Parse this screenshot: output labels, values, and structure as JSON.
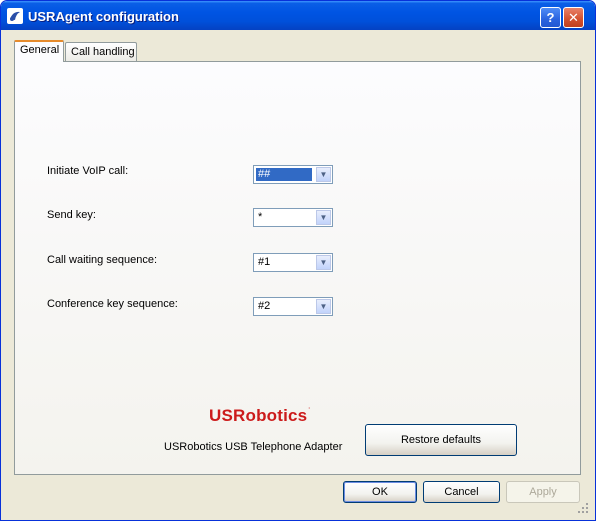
{
  "window": {
    "title": "USRAgent configuration",
    "help_label": "?",
    "close_label": "✕"
  },
  "tabs": [
    {
      "label": "General",
      "active": true
    },
    {
      "label": "Call handling",
      "active": false
    }
  ],
  "settings": [
    {
      "label": "Initiate VoIP call:",
      "value": "##"
    },
    {
      "label": "Send key:",
      "value": "*"
    },
    {
      "label": "Call waiting sequence:",
      "value": "#1"
    },
    {
      "label": "Conference key sequence:",
      "value": "#2"
    }
  ],
  "brand": {
    "logo_text": "USRobotics",
    "logo_mark": "·",
    "product_name": "USRobotics USB Telephone Adapter"
  },
  "buttons": {
    "restore": "Restore defaults",
    "ok": "OK",
    "cancel": "Cancel",
    "apply": "Apply"
  },
  "icons": {
    "combo_arrow": "▼"
  },
  "colors": {
    "titlebar": "#0054e3",
    "logo_red": "#cc1b1b",
    "selection": "#316ac5",
    "dialog_bg": "#ece9d8"
  }
}
